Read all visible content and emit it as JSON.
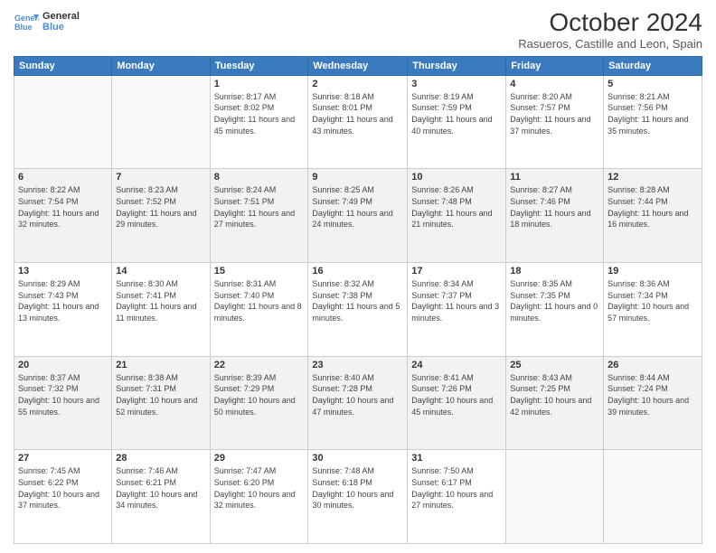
{
  "header": {
    "logo_line1": "General",
    "logo_line2": "Blue",
    "title": "October 2024",
    "subtitle": "Rasueros, Castille and Leon, Spain"
  },
  "weekdays": [
    "Sunday",
    "Monday",
    "Tuesday",
    "Wednesday",
    "Thursday",
    "Friday",
    "Saturday"
  ],
  "weeks": [
    [
      {
        "day": "",
        "info": ""
      },
      {
        "day": "",
        "info": ""
      },
      {
        "day": "1",
        "info": "Sunrise: 8:17 AM\nSunset: 8:02 PM\nDaylight: 11 hours and 45 minutes."
      },
      {
        "day": "2",
        "info": "Sunrise: 8:18 AM\nSunset: 8:01 PM\nDaylight: 11 hours and 43 minutes."
      },
      {
        "day": "3",
        "info": "Sunrise: 8:19 AM\nSunset: 7:59 PM\nDaylight: 11 hours and 40 minutes."
      },
      {
        "day": "4",
        "info": "Sunrise: 8:20 AM\nSunset: 7:57 PM\nDaylight: 11 hours and 37 minutes."
      },
      {
        "day": "5",
        "info": "Sunrise: 8:21 AM\nSunset: 7:56 PM\nDaylight: 11 hours and 35 minutes."
      }
    ],
    [
      {
        "day": "6",
        "info": "Sunrise: 8:22 AM\nSunset: 7:54 PM\nDaylight: 11 hours and 32 minutes."
      },
      {
        "day": "7",
        "info": "Sunrise: 8:23 AM\nSunset: 7:52 PM\nDaylight: 11 hours and 29 minutes."
      },
      {
        "day": "8",
        "info": "Sunrise: 8:24 AM\nSunset: 7:51 PM\nDaylight: 11 hours and 27 minutes."
      },
      {
        "day": "9",
        "info": "Sunrise: 8:25 AM\nSunset: 7:49 PM\nDaylight: 11 hours and 24 minutes."
      },
      {
        "day": "10",
        "info": "Sunrise: 8:26 AM\nSunset: 7:48 PM\nDaylight: 11 hours and 21 minutes."
      },
      {
        "day": "11",
        "info": "Sunrise: 8:27 AM\nSunset: 7:46 PM\nDaylight: 11 hours and 18 minutes."
      },
      {
        "day": "12",
        "info": "Sunrise: 8:28 AM\nSunset: 7:44 PM\nDaylight: 11 hours and 16 minutes."
      }
    ],
    [
      {
        "day": "13",
        "info": "Sunrise: 8:29 AM\nSunset: 7:43 PM\nDaylight: 11 hours and 13 minutes."
      },
      {
        "day": "14",
        "info": "Sunrise: 8:30 AM\nSunset: 7:41 PM\nDaylight: 11 hours and 11 minutes."
      },
      {
        "day": "15",
        "info": "Sunrise: 8:31 AM\nSunset: 7:40 PM\nDaylight: 11 hours and 8 minutes."
      },
      {
        "day": "16",
        "info": "Sunrise: 8:32 AM\nSunset: 7:38 PM\nDaylight: 11 hours and 5 minutes."
      },
      {
        "day": "17",
        "info": "Sunrise: 8:34 AM\nSunset: 7:37 PM\nDaylight: 11 hours and 3 minutes."
      },
      {
        "day": "18",
        "info": "Sunrise: 8:35 AM\nSunset: 7:35 PM\nDaylight: 11 hours and 0 minutes."
      },
      {
        "day": "19",
        "info": "Sunrise: 8:36 AM\nSunset: 7:34 PM\nDaylight: 10 hours and 57 minutes."
      }
    ],
    [
      {
        "day": "20",
        "info": "Sunrise: 8:37 AM\nSunset: 7:32 PM\nDaylight: 10 hours and 55 minutes."
      },
      {
        "day": "21",
        "info": "Sunrise: 8:38 AM\nSunset: 7:31 PM\nDaylight: 10 hours and 52 minutes."
      },
      {
        "day": "22",
        "info": "Sunrise: 8:39 AM\nSunset: 7:29 PM\nDaylight: 10 hours and 50 minutes."
      },
      {
        "day": "23",
        "info": "Sunrise: 8:40 AM\nSunset: 7:28 PM\nDaylight: 10 hours and 47 minutes."
      },
      {
        "day": "24",
        "info": "Sunrise: 8:41 AM\nSunset: 7:26 PM\nDaylight: 10 hours and 45 minutes."
      },
      {
        "day": "25",
        "info": "Sunrise: 8:43 AM\nSunset: 7:25 PM\nDaylight: 10 hours and 42 minutes."
      },
      {
        "day": "26",
        "info": "Sunrise: 8:44 AM\nSunset: 7:24 PM\nDaylight: 10 hours and 39 minutes."
      }
    ],
    [
      {
        "day": "27",
        "info": "Sunrise: 7:45 AM\nSunset: 6:22 PM\nDaylight: 10 hours and 37 minutes."
      },
      {
        "day": "28",
        "info": "Sunrise: 7:46 AM\nSunset: 6:21 PM\nDaylight: 10 hours and 34 minutes."
      },
      {
        "day": "29",
        "info": "Sunrise: 7:47 AM\nSunset: 6:20 PM\nDaylight: 10 hours and 32 minutes."
      },
      {
        "day": "30",
        "info": "Sunrise: 7:48 AM\nSunset: 6:18 PM\nDaylight: 10 hours and 30 minutes."
      },
      {
        "day": "31",
        "info": "Sunrise: 7:50 AM\nSunset: 6:17 PM\nDaylight: 10 hours and 27 minutes."
      },
      {
        "day": "",
        "info": ""
      },
      {
        "day": "",
        "info": ""
      }
    ]
  ]
}
